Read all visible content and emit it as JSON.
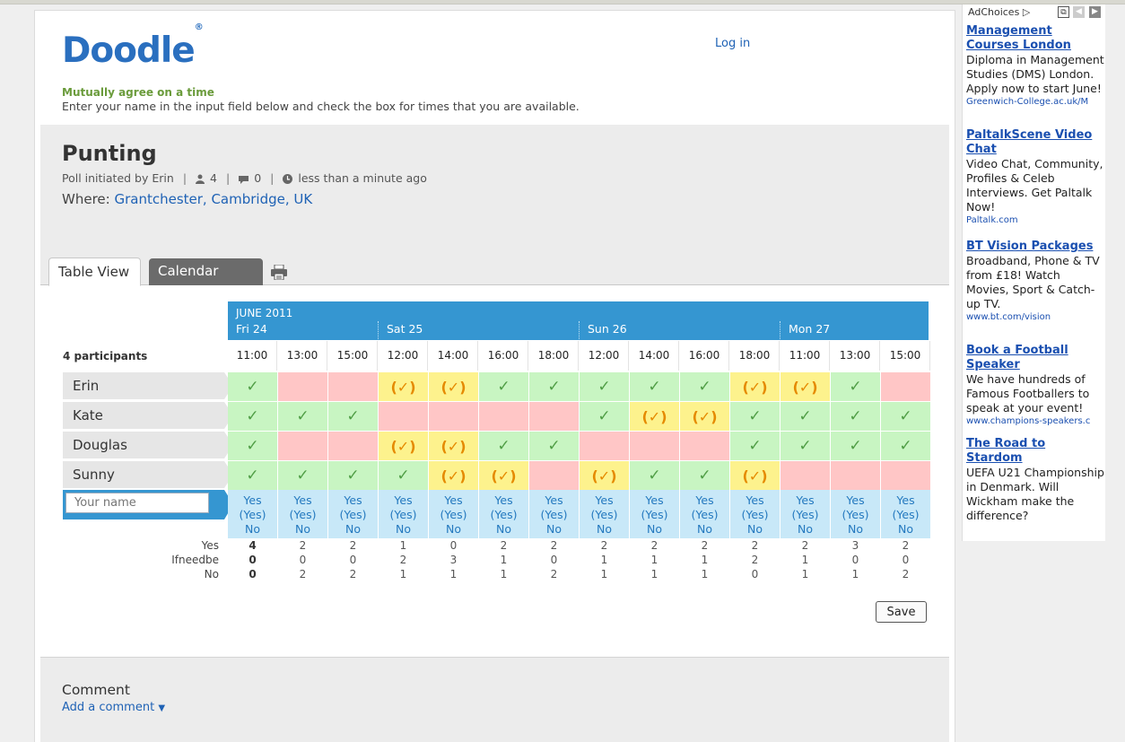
{
  "header": {
    "logo": "Doodle",
    "logo_mark": "®",
    "login": "Log in",
    "tagline": "Mutually agree on a time",
    "instructions": "Enter your name in the input field below and check the box for times that you are available."
  },
  "poll": {
    "title": "Punting",
    "initiated": "Poll initiated by Erin",
    "participants_count": "4",
    "comments_count": "0",
    "created": "less than a minute ago",
    "where_label": "Where:",
    "where_value": "Grantchester, Cambridge, UK"
  },
  "tabs": {
    "table": "Table View",
    "calendar": "Calendar View"
  },
  "table": {
    "month": "JUNE 2011",
    "days": [
      {
        "label": "Fri 24",
        "span": 3
      },
      {
        "label": "Sat 25",
        "span": 4
      },
      {
        "label": "Sun 26",
        "span": 4
      },
      {
        "label": "Mon 27",
        "span": 3
      }
    ],
    "participants_label": "4 participants",
    "times": [
      "11:00",
      "13:00",
      "15:00",
      "12:00",
      "14:00",
      "16:00",
      "18:00",
      "12:00",
      "14:00",
      "16:00",
      "18:00",
      "11:00",
      "13:00",
      "15:00"
    ],
    "rows": [
      {
        "name": "Erin",
        "cells": [
          "y",
          "n",
          "n",
          "m",
          "m",
          "y",
          "y",
          "y",
          "y",
          "y",
          "m",
          "m",
          "y",
          "n"
        ]
      },
      {
        "name": "Kate",
        "cells": [
          "y",
          "y",
          "y",
          "n",
          "n",
          "n",
          "n",
          "y",
          "m",
          "m",
          "y",
          "y",
          "y",
          "y"
        ]
      },
      {
        "name": "Douglas",
        "cells": [
          "y",
          "n",
          "n",
          "m",
          "m",
          "y",
          "y",
          "n",
          "n",
          "n",
          "y",
          "y",
          "y",
          "y"
        ]
      },
      {
        "name": "Sunny",
        "cells": [
          "y",
          "y",
          "y",
          "y",
          "m",
          "m",
          "n",
          "m",
          "y",
          "y",
          "m",
          "n",
          "n",
          "n"
        ]
      }
    ],
    "name_placeholder": "Your name",
    "option_yes": "Yes",
    "option_maybe": "(Yes)",
    "option_no": "No",
    "totals": {
      "labels": [
        "Yes",
        "Ifneedbe",
        "No"
      ],
      "yes": [
        "4",
        "2",
        "2",
        "1",
        "0",
        "2",
        "2",
        "2",
        "2",
        "2",
        "2",
        "2",
        "3",
        "2"
      ],
      "ifneedbe": [
        "0",
        "0",
        "0",
        "2",
        "3",
        "1",
        "0",
        "1",
        "1",
        "1",
        "2",
        "1",
        "0",
        "0"
      ],
      "no": [
        "0",
        "2",
        "2",
        "1",
        "1",
        "1",
        "2",
        "1",
        "1",
        "1",
        "0",
        "1",
        "1",
        "2"
      ]
    },
    "save": "Save"
  },
  "comment": {
    "title": "Comment",
    "add": "Add a comment"
  },
  "ads": {
    "adchoices": "AdChoices",
    "items": [
      {
        "title": "Management Courses London",
        "desc": "Diploma in Management Studies (DMS) London. Apply now to start June!",
        "url": "Greenwich-College.ac.uk/M"
      },
      {
        "title": "PaltalkScene Video Chat",
        "desc": "Video Chat, Community, Profiles & Celeb Interviews. Get Paltalk Now!",
        "url": "Paltalk.com"
      },
      {
        "title": "BT Vision Packages",
        "desc": "Broadband, Phone & TV from £18! Watch Movies, Sport & Catch-up TV.",
        "url": "www.bt.com/vision"
      },
      {
        "title": "Book a Football Speaker",
        "desc": "We have hundreds of Famous Footballers to speak at your event!",
        "url": "www.champions-speakers.c"
      },
      {
        "title": "The Road to Stardom",
        "desc": "UEFA U21 Championship in Denmark. Will Wickham make the difference?",
        "url": ""
      }
    ]
  },
  "colors": {
    "brand_blue": "#2a6fbf",
    "header_blue": "#3596d1",
    "yes_green": "#c8f5c2",
    "no_red": "#ffc6c6",
    "maybe_yellow": "#fdf28d",
    "tagline_green": "#6a9b3b"
  }
}
